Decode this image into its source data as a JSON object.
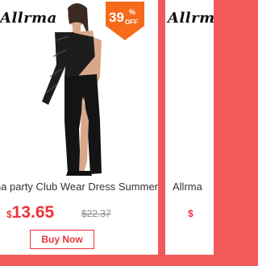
{
  "products": [
    {
      "brand": "Allrma",
      "badge": {
        "percent": "39",
        "pct_sign": "%",
        "off": "OFF",
        "color": "#f56a1b"
      },
      "title": "Allrma party Club Wear Dress Summer",
      "currency": "$",
      "price": "13.65",
      "old_price": "$22.37",
      "buy_label": "Buy Now"
    },
    {
      "brand": "Allrma",
      "title": "Allrma",
      "currency": "$"
    }
  ],
  "colors": {
    "background": "#f25a5a",
    "price": "#e8353a",
    "badge": "#f56a1b"
  }
}
